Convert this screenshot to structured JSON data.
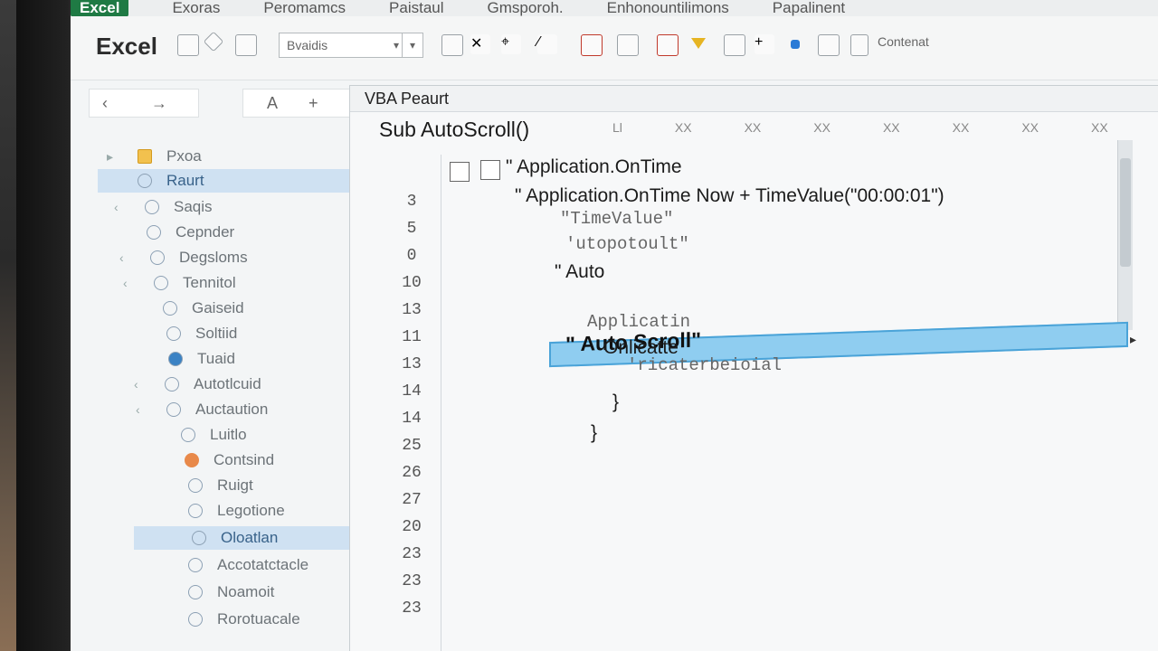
{
  "tabs": [
    "Excel",
    "Exoras",
    "Peromamcs",
    "Paistaul",
    "Gmsporoh.",
    "Enhonountilimons",
    "Papalinent"
  ],
  "ribbon": {
    "logo": "Excel",
    "font_value": "Bvaidis",
    "group_label": "Contenat"
  },
  "vba": {
    "window_title": "VBA Peaurt",
    "sub_header": "Sub AutoScroll()",
    "column_headers": [
      "Ll",
      "XX",
      "XX",
      "XX",
      "XX",
      "XX",
      "XX",
      "XX"
    ],
    "line_numbers": [
      "3",
      "5",
      "0",
      "10",
      "13",
      "11",
      "13",
      "14",
      "14",
      "25",
      "26",
      "27",
      "20",
      "23",
      "23",
      "23"
    ],
    "code_lines": [
      "\" Application.OnTime",
      "\" Application.OnTime Now + TimeValue(\"00:00:01\")",
      "\"TimeValue\"",
      "'utopotoult\"",
      "\" Auto",
      "\" Auto Scroll\"",
      "Applicatin",
      "Onlicatte",
      "'ricaterbeioial",
      "}",
      "}"
    ]
  },
  "tree": {
    "items": [
      "Pxoa",
      "Raurt",
      "Saqis",
      "Cepnder",
      "Degsloms",
      "Tennitol",
      "Gaiseid",
      "Soltiid",
      "Tuaid",
      "Autotlcuid",
      "Auctaution",
      "Luitlo",
      "Contsind",
      "Ruigt",
      "Legotione",
      "Oloatlan",
      "Accotatctacle",
      "Noamoit",
      "Rorotuacale"
    ]
  }
}
